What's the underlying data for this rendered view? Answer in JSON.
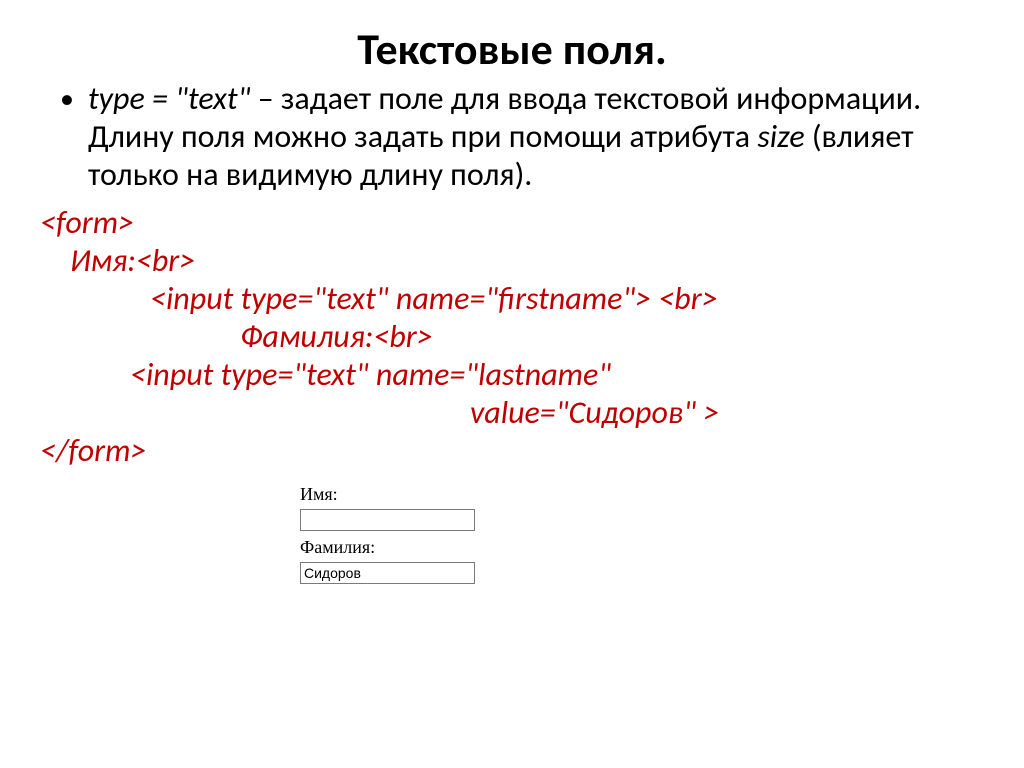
{
  "title": "Текстовые поля.",
  "bullet": {
    "lead": "type = \"text\"",
    "rest": " – задает поле для ввода текстовой информации. Длину поля можно задать при помощи атрибута ",
    "size_word": "size",
    "tail": " (влияет только на видимую длину поля)."
  },
  "code": {
    "l1": "<form>",
    "l2": "Имя:<br>",
    "l3": "<input type=\"text\" name=\"firstname\"> <br>",
    "l4": "Фамилия:<br>",
    "l5": "<input type=\"text\" name=\"lastname\"",
    "l6": "value=\"Сидоров\" >",
    "l7": "</form>"
  },
  "form": {
    "label_first": "Имя:",
    "value_first": "",
    "label_last": "Фамилия:",
    "value_last": "Сидоров"
  }
}
